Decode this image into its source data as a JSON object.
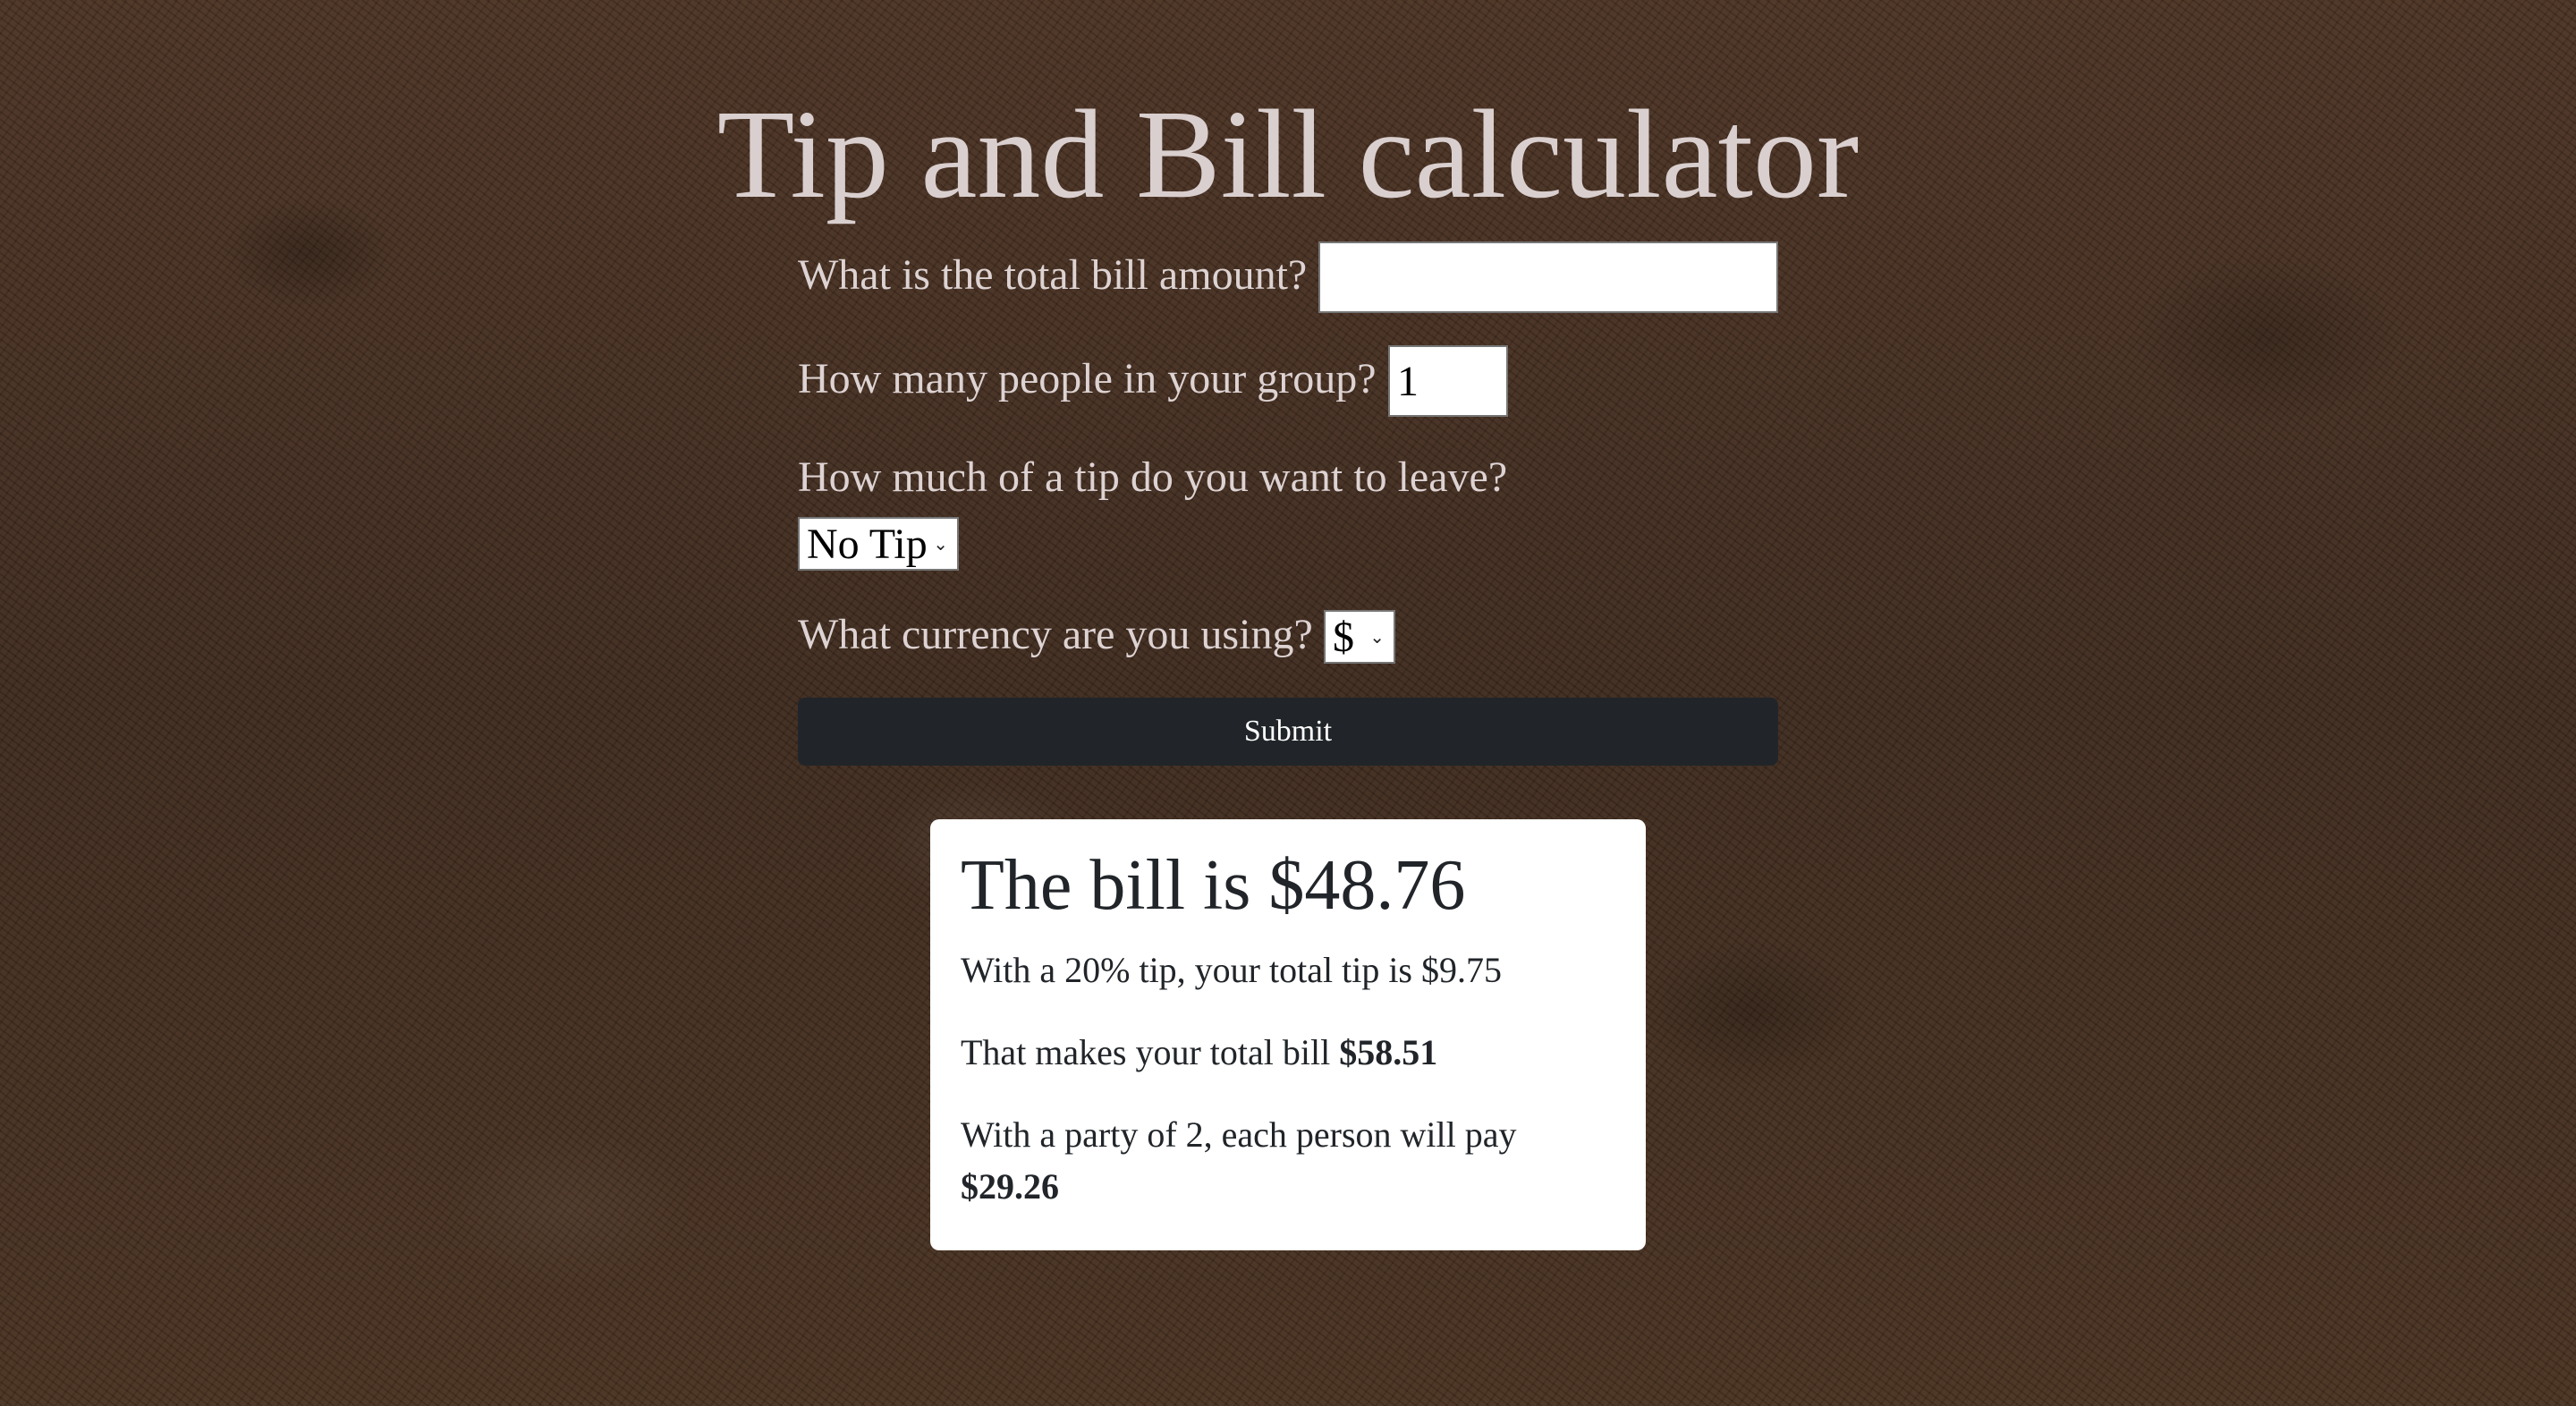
{
  "page": {
    "title": "Tip and Bill calculator"
  },
  "form": {
    "bill": {
      "label": "What is the total bill amount?",
      "value": ""
    },
    "people": {
      "label": "How many people in your group?",
      "value": "1"
    },
    "tip": {
      "label": "How much of a tip do you want to leave?",
      "selected": "No Tip"
    },
    "currency": {
      "label": "What currency are you using?",
      "selected": "$"
    },
    "submit_label": "Submit"
  },
  "result": {
    "bill_heading": "The bill is $48.76",
    "tip_line": "With a 20% tip, your total tip is $9.75",
    "total_prefix": "That makes your total bill ",
    "total_value": "$58.51",
    "party_prefix": "With a party of 2, each person will pay",
    "per_person_value": "$29.26"
  },
  "colors": {
    "button_bg": "#212529",
    "card_bg": "#ffffff",
    "label_text": "#ddd3d3"
  }
}
